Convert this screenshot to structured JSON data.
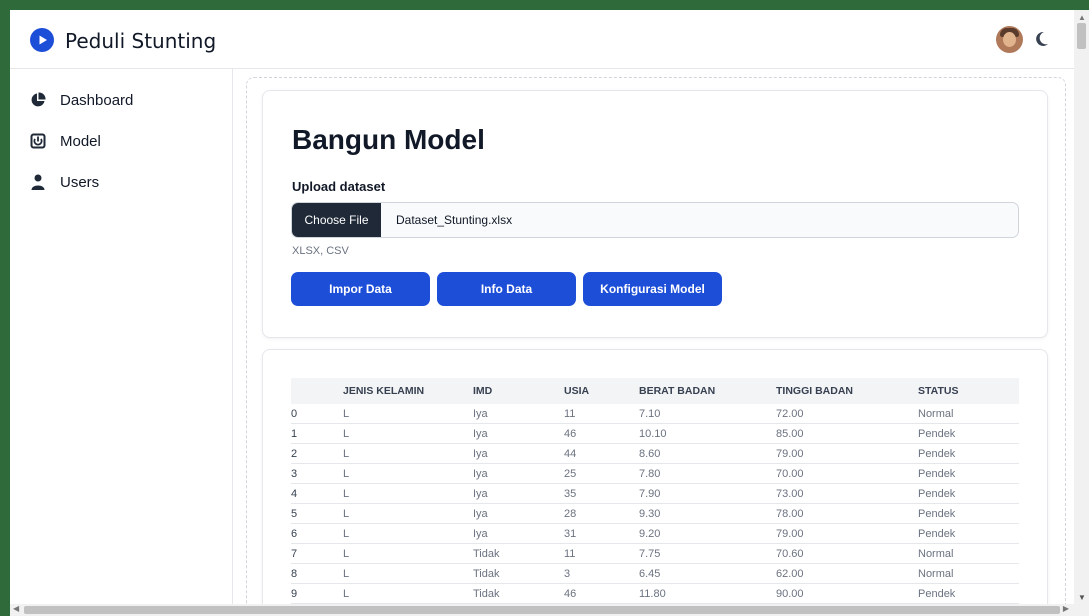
{
  "app": {
    "brand": "Peduli Stunting",
    "logo_icon": "play-circle-icon",
    "accent": "#1d4ed8"
  },
  "header": {
    "avatar_icon": "user-avatar",
    "theme_icon": "moon-icon"
  },
  "sidebar": {
    "items": [
      {
        "label": "Dashboard",
        "icon": "pie-chart-icon"
      },
      {
        "label": "Model",
        "icon": "power-box-icon"
      },
      {
        "label": "Users",
        "icon": "user-icon"
      }
    ]
  },
  "page": {
    "title": "Bangun Model",
    "upload_label": "Upload dataset",
    "file_button": "Choose File",
    "file_name": "Dataset_Stunting.xlsx",
    "hint": "XLSX, CSV",
    "buttons": {
      "import": "Impor Data",
      "info": "Info Data",
      "config": "Konfigurasi Model"
    }
  },
  "table": {
    "columns": [
      "",
      "JENIS KELAMIN",
      "IMD",
      "USIA",
      "BERAT BADAN",
      "TINGGI BADAN",
      "STATUS"
    ],
    "rows": [
      [
        "0",
        "L",
        "Iya",
        "11",
        "7.10",
        "72.00",
        "Normal"
      ],
      [
        "1",
        "L",
        "Iya",
        "46",
        "10.10",
        "85.00",
        "Pendek"
      ],
      [
        "2",
        "L",
        "Iya",
        "44",
        "8.60",
        "79.00",
        "Pendek"
      ],
      [
        "3",
        "L",
        "Iya",
        "25",
        "7.80",
        "70.00",
        "Pendek"
      ],
      [
        "4",
        "L",
        "Iya",
        "35",
        "7.90",
        "73.00",
        "Pendek"
      ],
      [
        "5",
        "L",
        "Iya",
        "28",
        "9.30",
        "78.00",
        "Pendek"
      ],
      [
        "6",
        "L",
        "Iya",
        "31",
        "9.20",
        "79.00",
        "Pendek"
      ],
      [
        "7",
        "L",
        "Tidak",
        "11",
        "7.75",
        "70.60",
        "Normal"
      ],
      [
        "8",
        "L",
        "Tidak",
        "3",
        "6.45",
        "62.00",
        "Normal"
      ],
      [
        "9",
        "L",
        "Tidak",
        "46",
        "11.80",
        "90.00",
        "Pendek"
      ]
    ]
  }
}
